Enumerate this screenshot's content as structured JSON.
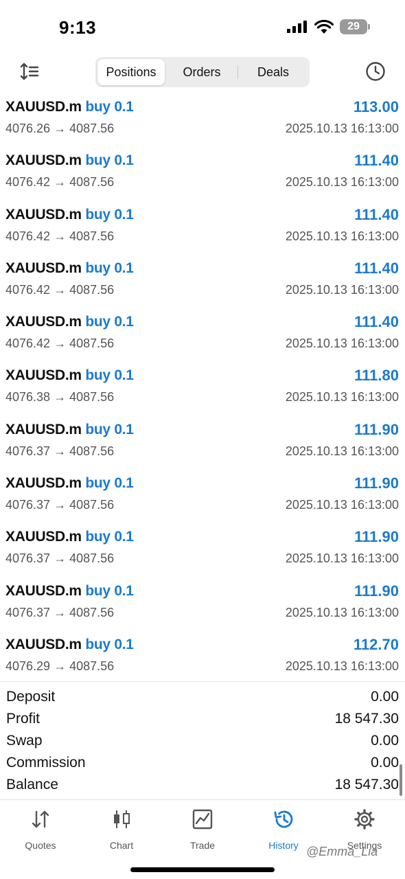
{
  "status_bar": {
    "time": "9:13",
    "battery": "29"
  },
  "toolbar": {
    "tabs": [
      {
        "label": "Positions",
        "active": true
      },
      {
        "label": "Orders",
        "active": false
      },
      {
        "label": "Deals",
        "active": false
      }
    ],
    "left_icon": "sort-icon",
    "right_icon": "clock-icon"
  },
  "positions": [
    {
      "symbol": "XAUUSD.m",
      "type": "buy 0.1",
      "profit": "113.00",
      "open": "4076.26",
      "close": "4087.56",
      "arrow": "→",
      "time": "2025.10.13 16:13:00"
    },
    {
      "symbol": "XAUUSD.m",
      "type": "buy 0.1",
      "profit": "111.40",
      "open": "4076.42",
      "close": "4087.56",
      "arrow": "→",
      "time": "2025.10.13 16:13:00"
    },
    {
      "symbol": "XAUUSD.m",
      "type": "buy 0.1",
      "profit": "111.40",
      "open": "4076.42",
      "close": "4087.56",
      "arrow": "→",
      "time": "2025.10.13 16:13:00"
    },
    {
      "symbol": "XAUUSD.m",
      "type": "buy 0.1",
      "profit": "111.40",
      "open": "4076.42",
      "close": "4087.56",
      "arrow": "→",
      "time": "2025.10.13 16:13:00"
    },
    {
      "symbol": "XAUUSD.m",
      "type": "buy 0.1",
      "profit": "111.40",
      "open": "4076.42",
      "close": "4087.56",
      "arrow": "→",
      "time": "2025.10.13 16:13:00"
    },
    {
      "symbol": "XAUUSD.m",
      "type": "buy 0.1",
      "profit": "111.80",
      "open": "4076.38",
      "close": "4087.56",
      "arrow": "→",
      "time": "2025.10.13 16:13:00"
    },
    {
      "symbol": "XAUUSD.m",
      "type": "buy 0.1",
      "profit": "111.90",
      "open": "4076.37",
      "close": "4087.56",
      "arrow": "→",
      "time": "2025.10.13 16:13:00"
    },
    {
      "symbol": "XAUUSD.m",
      "type": "buy 0.1",
      "profit": "111.90",
      "open": "4076.37",
      "close": "4087.56",
      "arrow": "→",
      "time": "2025.10.13 16:13:00"
    },
    {
      "symbol": "XAUUSD.m",
      "type": "buy 0.1",
      "profit": "111.90",
      "open": "4076.37",
      "close": "4087.56",
      "arrow": "→",
      "time": "2025.10.13 16:13:00"
    },
    {
      "symbol": "XAUUSD.m",
      "type": "buy 0.1",
      "profit": "111.90",
      "open": "4076.37",
      "close": "4087.56",
      "arrow": "→",
      "time": "2025.10.13 16:13:00"
    },
    {
      "symbol": "XAUUSD.m",
      "type": "buy 0.1",
      "profit": "112.70",
      "open": "4076.29",
      "close": "4087.56",
      "arrow": "→",
      "time": "2025.10.13 16:13:00"
    }
  ],
  "summary": [
    {
      "label": "Deposit",
      "value": "0.00"
    },
    {
      "label": "Profit",
      "value": "18 547.30"
    },
    {
      "label": "Swap",
      "value": "0.00"
    },
    {
      "label": "Commission",
      "value": "0.00"
    },
    {
      "label": "Balance",
      "value": "18 547.30"
    }
  ],
  "tab_bar": [
    {
      "label": "Quotes",
      "icon": "quotes-icon",
      "active": false
    },
    {
      "label": "Chart",
      "icon": "chart-icon",
      "active": false
    },
    {
      "label": "Trade",
      "icon": "trade-icon",
      "active": false
    },
    {
      "label": "History",
      "icon": "history-icon",
      "active": true
    },
    {
      "label": "Settings",
      "icon": "gear-icon",
      "active": false
    }
  ],
  "watermark": "@Emma_Lia",
  "colors": {
    "accent": "#1a7ad0",
    "text": "#111111",
    "muted": "#555555"
  }
}
